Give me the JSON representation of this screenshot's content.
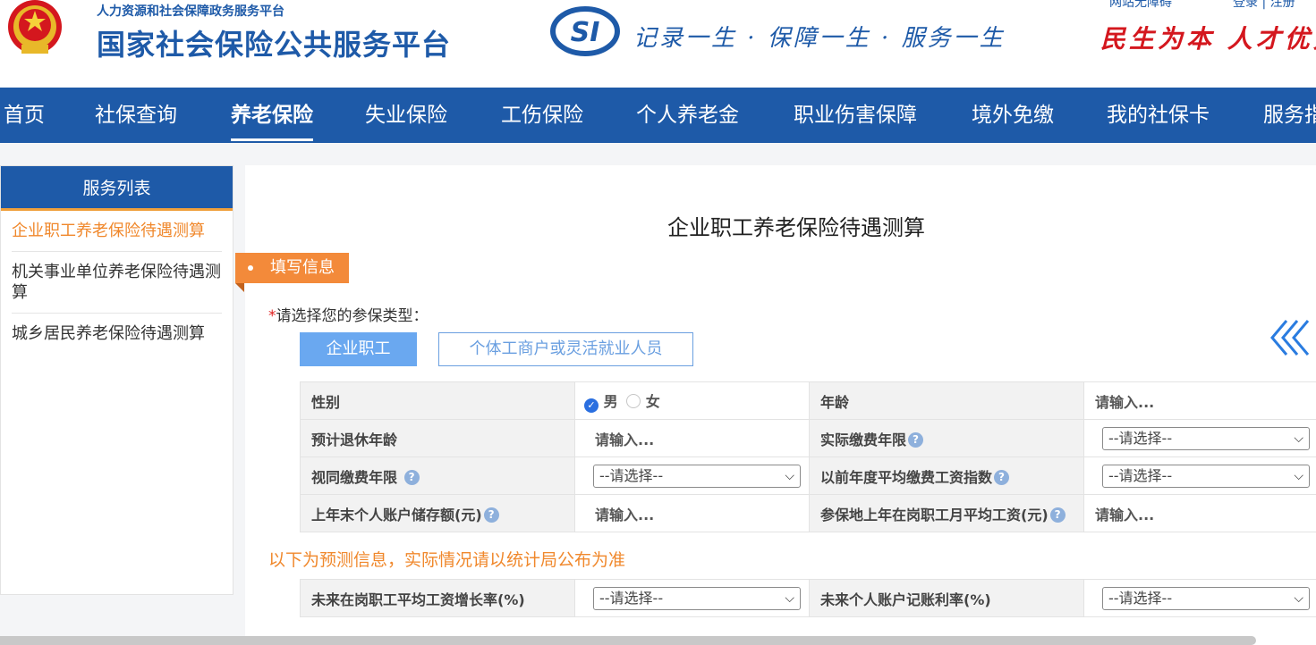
{
  "header": {
    "org_small": "人力资源和社会保障政务服务平台",
    "org_big": "国家社会保险公共服务平台",
    "slogan": "记录一生 · 保障一生 · 服务一生",
    "slogan2": "民生为本 人才优先",
    "toplinks": [
      "网站无障碍",
      "登录 | 注册"
    ]
  },
  "nav": {
    "items": [
      "首页",
      "社保查询",
      "养老保险",
      "失业保险",
      "工伤保险",
      "个人养老金",
      "职业伤害保障",
      "境外免缴",
      "我的社保卡",
      "服务指南"
    ],
    "active_index": 2
  },
  "sidebar": {
    "heading": "服务列表",
    "items": [
      "企业职工养老保险待遇测算",
      "机关事业单位养老保险待遇测算",
      "城乡居民养老保险待遇测算"
    ],
    "active_index": 0
  },
  "main": {
    "title": "企业职工养老保险待遇测算",
    "fill_tag": "填写信息",
    "type_star": "*",
    "type_label": "请选择您的参保类型：",
    "type_options": [
      "企业职工",
      "个体工商户或灵活就业人员"
    ],
    "type_selected": "企业职工",
    "help_mark": "?",
    "rows": {
      "gender_label": "性别",
      "gender_male": "男",
      "gender_female": "女",
      "age_label": "年龄",
      "age_placeholder": "请输入...",
      "retire_age_label": "预计退休年龄",
      "retire_age_placeholder": "请输入...",
      "paid_years_label": "实际缴费年限",
      "paid_years_select": "--请选择--",
      "deemed_years_label": "视同缴费年限",
      "deemed_years_select": "--请选择--",
      "wage_index_label": "以前年度平均缴费工资指数",
      "wage_index_select": "--请选择--",
      "account_balance_label": "上年末个人账户储存额(元)",
      "account_balance_placeholder": "请输入...",
      "avg_wage_label": "参保地上年在岗职工月平均工资(元)",
      "avg_wage_placeholder": "请输入..."
    },
    "forecast_note": "以下为预测信息，实际情况请以统计局公布为准",
    "forecast": {
      "wage_growth_label": "未来在岗职工平均工资增长率(%)",
      "wage_growth_select": "--请选择--",
      "interest_rate_label": "未来个人账户记账利率(%)",
      "interest_rate_select": "--请选择--"
    }
  },
  "colors": {
    "brand_blue": "#1e5aa8",
    "accent_orange": "#f38a3a",
    "slogan_red": "#d4171e"
  }
}
